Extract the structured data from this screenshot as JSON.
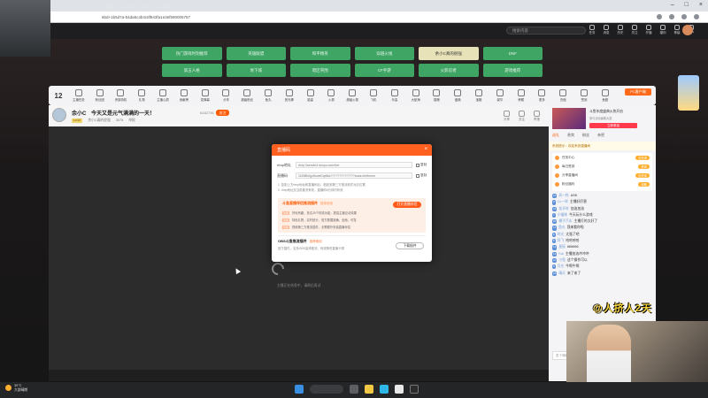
{
  "browser": {
    "url": "6bd+1b5d7a-54da5c4b4c8f943fa1e3ef590005757"
  },
  "site_nav": {
    "items": [
      "直播",
      "游戏",
      "鱼吧",
      "视频"
    ],
    "search_placeholder": "搜索内容"
  },
  "header_icons": [
    "任务",
    "消息",
    "历史",
    "关注",
    "开播",
    "福利",
    "等级",
    "用户"
  ],
  "categories": [
    "热门游戏时刻推荐",
    "英雄联盟",
    "和平精英",
    "穿越火线",
    "余小C真的很强",
    "DNF",
    "第五人格",
    "地下城",
    "暗区突围",
    "CF手游",
    "火影忍者",
    "游戏推荐"
  ],
  "gift_bar": {
    "level": "12",
    "items": [
      "主播任务",
      "粉丝团",
      "贵族特权",
      "礼物",
      "主播心愿",
      "贡献榜",
      "发弹幕",
      "分享",
      "超级粉丝",
      "鱼丸",
      "荧光棒",
      "能量",
      "火箭",
      "超级火箭",
      "飞机",
      "乐高",
      "大航海",
      "猫粮",
      "盛典",
      "宝箱",
      "豪华",
      "荣耀",
      "更多",
      "充值",
      "签到",
      "鱼翅",
      "领取",
      "福利"
    ],
    "pc_client": "PC客户端"
  },
  "stream": {
    "streamer": "余小C",
    "title": "今天又是元气满满的一天！",
    "room_number": "8182736",
    "follow_badge": "关注",
    "meta_tag": "Lv12",
    "category": "余小C真的很强",
    "viewers": "3075",
    "report": "举报",
    "actions": [
      "分享",
      "关注",
      "举报"
    ]
  },
  "dialog": {
    "title": "直播码",
    "rtmp_label": "rtmp地址",
    "rtmp_value": "rtmp://sendtc3.douyu.com/live",
    "code_label": "直播码",
    "code_value": "11698b2gz5oweDqr8ks??????????????auas=fmfbnms",
    "copy_label": "复制",
    "note_1": "1. 复制上方rtmp地址和直播码后，粘贴到第三方推流软件对应位置",
    "note_2": "2. rtmp地址仅当前推流有效，直播码5分钟内有效",
    "plugin_title": "斗鱼直播伴侣推流插件",
    "plugin_subtitle": "推荐使用",
    "open_plugin": "打开直播伴侣",
    "features": [
      {
        "tag": "功能",
        "text": "好玩有趣，多达20个特效功能，提高主播互动效果"
      },
      {
        "tag": "功能",
        "text": "特色礼物，实时统计，官方数据准确，全面，可靠"
      },
      {
        "tag": "功能",
        "text": "视频第三方推流插件，无需额外安装直播伴侣"
      }
    ],
    "obs_title": "OBS斗鱼推流插件",
    "obs_subtitle": "推荐使用",
    "obs_desc": "官方插件，支持OBS高清推流，有效降低直播卡顿",
    "download_plugin": "下载插件"
  },
  "video": {
    "loading_text": "主播正在休息中，请稍后再试"
  },
  "right_panel": {
    "promo_title": "斗鱼年度盛典火热开启",
    "promo_sub": "参与活动赢取大奖",
    "promo_btn": "立即参加",
    "tabs": [
      "送礼",
      "贵宾",
      "粉丝",
      "亲密"
    ],
    "notice": "系统提示：欢迎来到直播间",
    "tasks": [
      {
        "label": "任务中心",
        "btn": "去完成"
      },
      {
        "label": "每日签到",
        "btn": "签到"
      },
      {
        "label": "分享直播间",
        "btn": "去完成"
      },
      {
        "label": "粉丝福利",
        "btn": "领取"
      }
    ],
    "chat": [
      {
        "lv": "12",
        "user": "风一样",
        "text": "ASK"
      },
      {
        "lv": "9",
        "user": "Cc一样",
        "text": "主播好厉害"
      },
      {
        "lv": "15",
        "user": "花开时",
        "text": "加油加油"
      },
      {
        "lv": "7",
        "user": "小猫咪",
        "text": "今天玩什么游戏"
      },
      {
        "lv": "20",
        "user": "橘子汽水",
        "text": "主播打的太好了"
      },
      {
        "lv": "11",
        "user": "鱼丸",
        "text": "我来看你啦"
      },
      {
        "lv": "8",
        "user": "时光",
        "text": "太强了吧"
      },
      {
        "lv": "5",
        "user": "阿飞",
        "text": "哈哈哈哈"
      },
      {
        "lv": "13",
        "user": "星辰",
        "text": "666666"
      },
      {
        "lv": "16",
        "user": "Kai",
        "text": "主播加油冲冲冲"
      },
      {
        "lv": "10",
        "user": "小鱼",
        "text": "这个操作可以"
      },
      {
        "lv": "6",
        "user": "月光",
        "text": "牛啊牛啊"
      },
      {
        "lv": "18",
        "user": "晴天",
        "text": "来了来了"
      }
    ],
    "chat_placeholder": "发个弹幕吧",
    "send": "发送"
  },
  "overlay_text": "@人挤人2天",
  "taskbar": {
    "weather_temp": "30°C",
    "weather_desc": "大部晴朗"
  }
}
